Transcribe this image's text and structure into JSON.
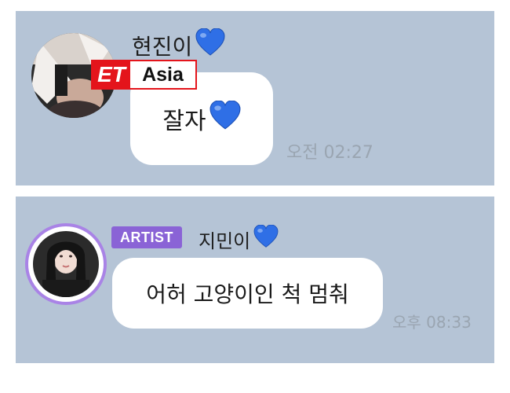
{
  "top_message": {
    "sender_name": "현진이",
    "heart_icon": "blue-heart-icon",
    "text": "잘자",
    "time": "오전 02:27"
  },
  "bottom_message": {
    "badge": "ARTIST",
    "sender_name": "지민이",
    "heart_icon": "blue-heart-icon",
    "text": "어허 고양이인 척 멈춰",
    "time": "오후 08:33"
  },
  "watermark": {
    "left": "ET",
    "right": "Asia"
  },
  "colors": {
    "panel_background": "#b5c4d6",
    "bubble_background": "#ffffff",
    "artist_badge": "#8a63d6",
    "heart": "#2f6fe6",
    "logo_red": "#e4141b"
  }
}
